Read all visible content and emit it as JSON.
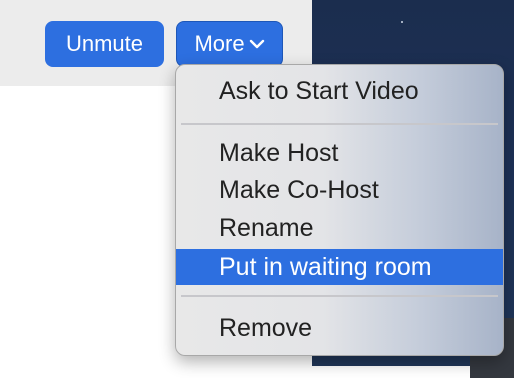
{
  "toolbar": {
    "unmute_label": "Unmute",
    "more_label": "More"
  },
  "menu": {
    "items": [
      {
        "label": "Ask to Start Video"
      },
      {
        "label": "Make Host"
      },
      {
        "label": "Make Co-Host"
      },
      {
        "label": "Rename"
      },
      {
        "label": "Put in waiting room",
        "highlighted": true
      },
      {
        "label": "Remove"
      }
    ]
  },
  "icons": {
    "more_caret": "chevron-down-icon"
  },
  "colors": {
    "button_blue": "#2d6fe0",
    "highlight_blue": "#2d6fe0",
    "toolbar_background": "#ececec",
    "right_background": "#1d3157"
  }
}
